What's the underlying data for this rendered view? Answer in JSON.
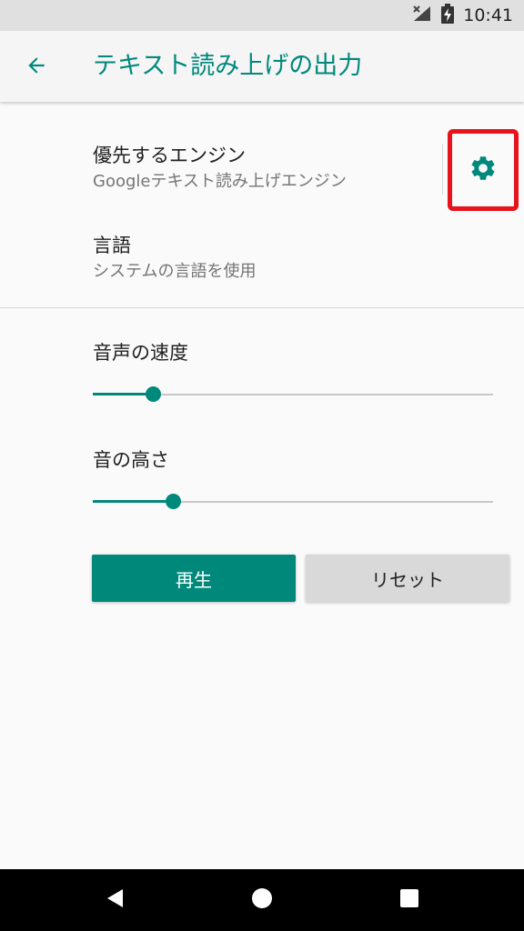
{
  "status_bar": {
    "time": "10:41",
    "icons": [
      "signal-no-service-icon",
      "battery-charging-icon"
    ]
  },
  "app_bar": {
    "title": "テキスト読み上げの出力",
    "back_icon": "arrow-back-icon"
  },
  "preferences": {
    "engine": {
      "title": "優先するエンジン",
      "summary": "Googleテキスト読み上げエンジン",
      "settings_icon": "gear-icon"
    },
    "language": {
      "title": "言語",
      "summary": "システムの言語を使用"
    }
  },
  "sliders": {
    "speech_rate": {
      "label": "音声の速度",
      "fraction": 0.15
    },
    "pitch": {
      "label": "音の高さ",
      "fraction": 0.2
    }
  },
  "buttons": {
    "play_label": "再生",
    "reset_label": "リセット"
  },
  "nav_bar": {
    "icons": [
      "back-triangle-icon",
      "home-circle-icon",
      "recents-square-icon"
    ]
  },
  "colors": {
    "accent": "#00897b",
    "highlight_box": "#e8131a",
    "background": "#fafafa"
  }
}
